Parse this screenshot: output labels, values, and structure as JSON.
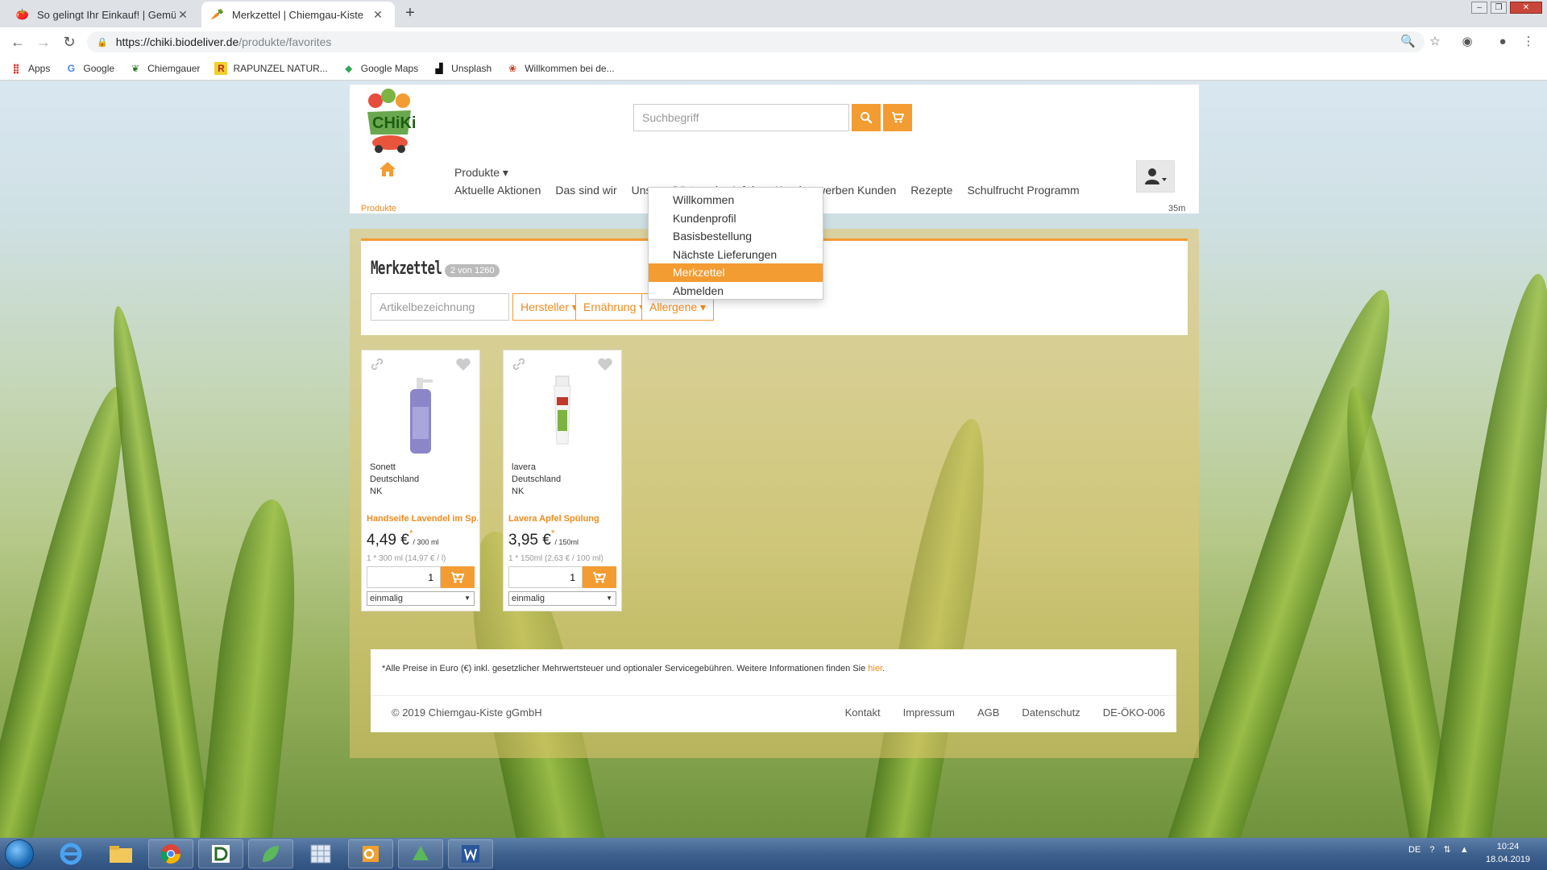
{
  "browser": {
    "tabs": [
      {
        "title": "So gelingt Ihr Einkauf! | Gemüsek",
        "active": false
      },
      {
        "title": "Merkzettel | Chiemgau-Kiste",
        "active": true
      }
    ],
    "url_host": "https://chiki.biodeliver.de",
    "url_path": "/produkte/favorites",
    "bookmarks": [
      "Apps",
      "Google",
      "Chiemgauer",
      "RAPUNZEL NATUR...",
      "Google Maps",
      "Unsplash",
      "Willkommen bei de..."
    ]
  },
  "site": {
    "search_placeholder": "Suchbegriff",
    "produkte_label": "Produkte ▾",
    "menu": [
      "Aktuelle Aktionen",
      "Das sind wir",
      "Unsere Gärtnerei",
      "Info´s",
      "Kunden werben Kunden",
      "Rezepte",
      "Schulfrucht Programm"
    ],
    "breadcrumb": "Produkte",
    "header_right_fragment": "35m",
    "logo_text": "CHiKi"
  },
  "user_menu": {
    "items": [
      "Willkommen",
      "Kundenprofil",
      "Basisbestellung",
      "Nächste Lieferungen",
      "Merkzettel",
      "Abmelden"
    ],
    "active_index": 4
  },
  "favorites": {
    "title": "Merkzettel",
    "count_badge": "2 von 1260",
    "filter_placeholder": "Artikelbezeichnung",
    "filters": [
      "Hersteller",
      "Ernährung",
      "Allergene"
    ]
  },
  "products": [
    {
      "brand": "Sonett",
      "origin": "Deutschland",
      "label": "NK",
      "name": "Handseife Lavendel im Sp...",
      "price": "4,49 €",
      "unit": "/ 300 ml",
      "unit_price": "1 * 300 ml (14,97 € / l)",
      "qty": "1",
      "frequency": "einmalig"
    },
    {
      "brand": "lavera",
      "origin": "Deutschland",
      "label": "NK",
      "name": "Lavera Apfel Spülung",
      "price": "3,95 €",
      "unit": "/ 150ml",
      "unit_price": "1 * 150ml (2,63 € / 100 ml)",
      "qty": "1",
      "frequency": "einmalig"
    }
  ],
  "footer": {
    "note": "*Alle Preise in Euro (€) inkl. gesetzlicher Mehrwertsteuer und optionaler Servicegebühren.   Weitere Informationen finden Sie ",
    "note_link": "hier",
    "note_end": ".",
    "copyright": "© 2019 Chiemgau-Kiste gGmbH",
    "links": [
      "Kontakt",
      "Impressum",
      "AGB",
      "Datenschutz",
      "DE-ÖKO-006"
    ]
  },
  "taskbar": {
    "lang": "DE",
    "time": "10:24",
    "date": "18.04.2019"
  },
  "colors": {
    "accent": "#f39c32",
    "accent_text": "#f08a1c"
  }
}
